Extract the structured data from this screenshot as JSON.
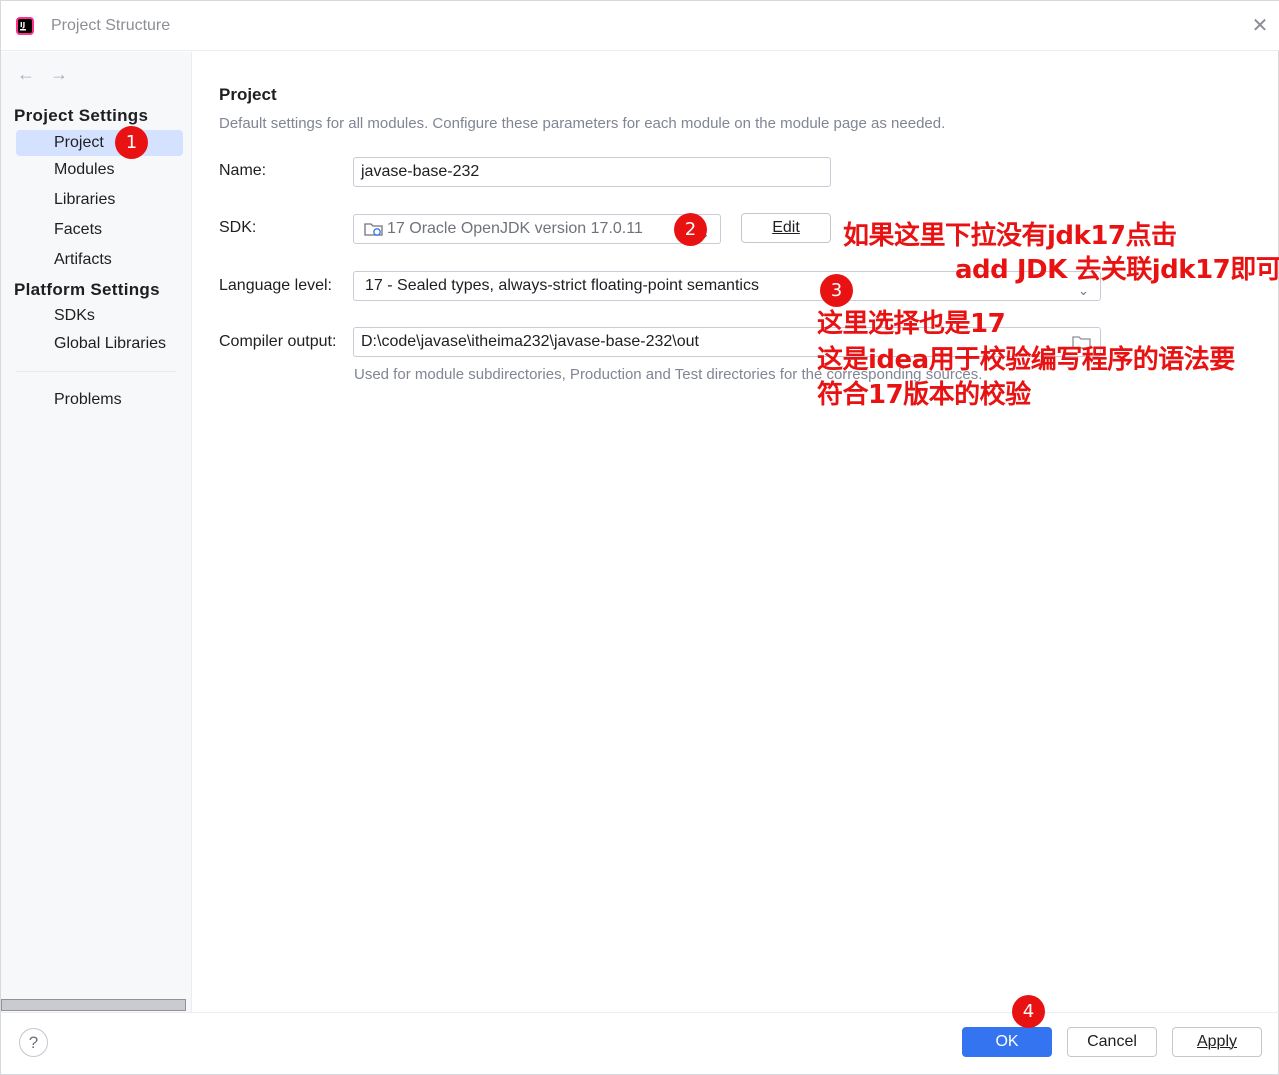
{
  "window": {
    "title": "Project Structure",
    "close_glyph": "✕"
  },
  "sidebar": {
    "back_glyph": "←",
    "forward_glyph": "→",
    "project_settings_heading": "Project Settings",
    "project_settings_items": [
      {
        "label": "Project",
        "selected": true
      },
      {
        "label": "Modules"
      },
      {
        "label": "Libraries"
      },
      {
        "label": "Facets"
      },
      {
        "label": "Artifacts"
      }
    ],
    "platform_settings_heading": "Platform Settings",
    "platform_settings_items": [
      {
        "label": "SDKs"
      },
      {
        "label": "Global Libraries"
      }
    ],
    "problems_label": "Problems"
  },
  "main": {
    "title": "Project",
    "description": "Default settings for all modules. Configure these parameters for each module on the module page as needed.",
    "name_label": "Name:",
    "name_value": "javase-base-232",
    "sdk_label": "SDK:",
    "sdk_value": "17 Oracle OpenJDK version 17.0.11",
    "edit_label": "Edit",
    "language_level_label": "Language level:",
    "language_level_value": "17 - Sealed types, always-strict floating-point semantics",
    "compiler_output_label": "Compiler output:",
    "compiler_output_value": "D:\\code\\javase\\itheima232\\javase-base-232\\out",
    "compiler_output_hint": "Used for module subdirectories, Production and Test directories for the corresponding sources."
  },
  "footer": {
    "help_glyph": "?",
    "ok_label": "OK",
    "cancel_label": "Cancel",
    "apply_label": "Apply"
  },
  "annotations": {
    "badges": [
      "1",
      "2",
      "3",
      "4"
    ],
    "note_sdk_line1": "如果这里下拉没有jdk17点击",
    "note_sdk_line2": "add JDK 去关联jdk17即可",
    "note_lang_line1": "这里选择也是17",
    "note_lang_line2": "这是idea用于校验编写程序的语法要",
    "note_lang_line3": "符合17版本的校验",
    "color": "#e81212"
  },
  "colors": {
    "accent": "#3574f0",
    "selection": "#d4e2ff"
  }
}
